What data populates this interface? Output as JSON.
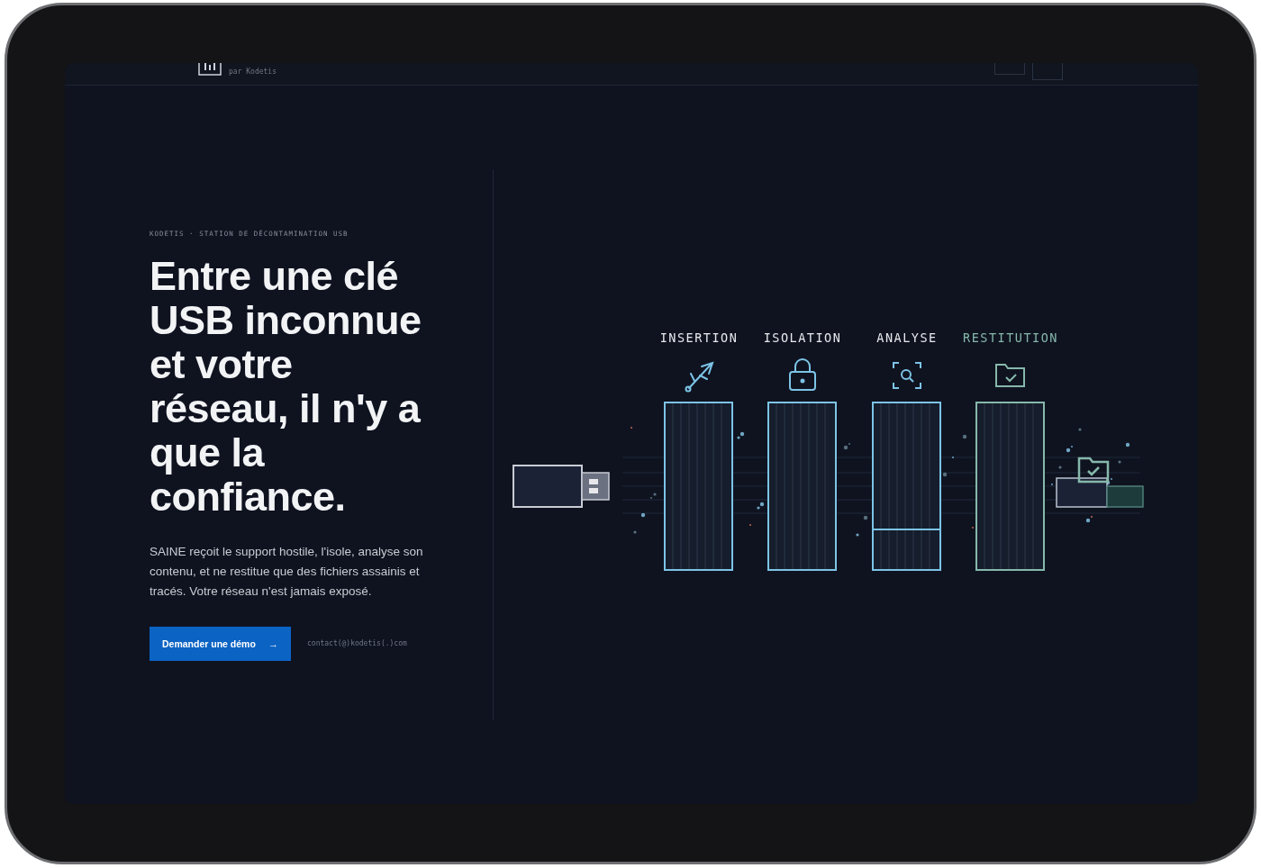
{
  "header": {
    "byline": "par Kodetis"
  },
  "hero": {
    "eyebrow": "KODETIS · STATION DE DÉCONTAMINATION USB",
    "title": "Entre une clé USB inconnue et votre réseau, il n'y a que la confiance.",
    "description": "SAINE reçoit le support hostile, l'isole, analyse son contenu, et ne restitue que des fichiers assainis et tracés. Votre réseau n'est jamais exposé.",
    "cta": {
      "label": "Demander une démo",
      "icon": "→"
    },
    "contact": "contact(@)kodetis(.)com"
  },
  "stages": [
    {
      "label": "INSERTION",
      "kind": "usb",
      "color": "#7cc4e6",
      "highlighted": false
    },
    {
      "label": "ISOLATION",
      "kind": "lock",
      "color": "#7cc4e6",
      "highlighted": false
    },
    {
      "label": "ANALYSE",
      "kind": "scan",
      "color": "#7cc4e6",
      "highlighted": false
    },
    {
      "label": "RESTITUTION",
      "kind": "folder",
      "color": "#86b8ab",
      "highlighted": true
    }
  ]
}
